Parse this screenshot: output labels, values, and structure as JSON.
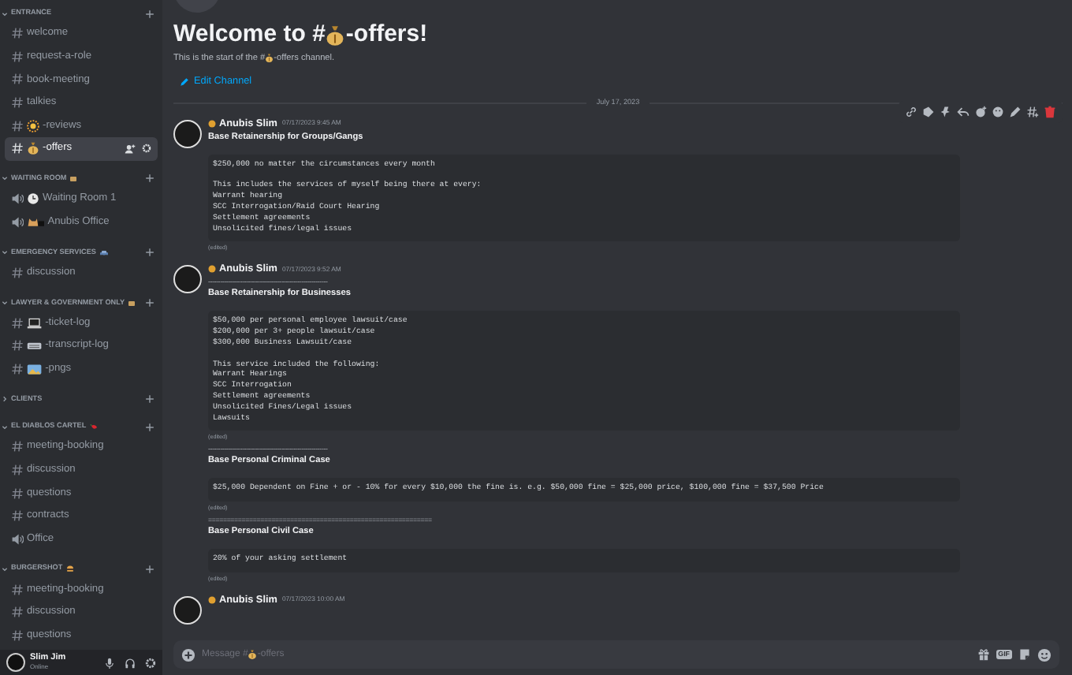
{
  "sidebar": {
    "categories": [
      {
        "name": "ENTRANCE",
        "expanded": true,
        "channels": [
          {
            "name": "welcome",
            "kind": "text",
            "selected": false
          },
          {
            "name": "request-a-role",
            "kind": "text",
            "selected": false
          },
          {
            "name": "book-meeting",
            "kind": "text",
            "selected": false
          },
          {
            "name": "talkies",
            "kind": "text",
            "selected": false
          },
          {
            "name": "-reviews",
            "kind": "text",
            "emoji": {
              "kind": "sun"
            },
            "selected": false
          },
          {
            "name": "-offers",
            "kind": "text",
            "emoji": {
              "kind": "moneybag"
            },
            "selected": true
          }
        ]
      },
      {
        "name": "WAITING ROOM",
        "emoji": {
          "kind": "box"
        },
        "expanded": true,
        "channels": [
          {
            "name": "Waiting Room 1",
            "kind": "voice",
            "emoji": {
              "kind": "clock"
            },
            "selected": false
          },
          {
            "name": "Anubis Office",
            "kind": "voice",
            "emoji": {
              "kind": "dog"
            },
            "selected": false
          }
        ]
      },
      {
        "name": "EMERGENCY SERVICES",
        "emoji": {
          "kind": "car"
        },
        "expanded": true,
        "channels": [
          {
            "name": "discussion",
            "kind": "text",
            "selected": false
          }
        ]
      },
      {
        "name": "LAWYER & GOVERNMENT ONLY",
        "emoji": {
          "kind": "box"
        },
        "expanded": true,
        "channels": [
          {
            "name": "-ticket-log",
            "kind": "text",
            "emoji": {
              "kind": "laptop"
            },
            "selected": false
          },
          {
            "name": "-transcript-log",
            "kind": "text",
            "emoji": {
              "kind": "keyboard"
            },
            "selected": false
          },
          {
            "name": "-pngs",
            "kind": "text",
            "emoji": {
              "kind": "picture"
            },
            "selected": false
          }
        ]
      },
      {
        "name": "CLIENTS",
        "expanded": false
      },
      {
        "name": "EL DIABLOS CARTEL",
        "emoji": {
          "kind": "pepper"
        },
        "expanded": true,
        "channels": [
          {
            "name": "meeting-booking",
            "kind": "text",
            "selected": false
          },
          {
            "name": "discussion",
            "kind": "text",
            "selected": false
          },
          {
            "name": "questions",
            "kind": "text",
            "selected": false
          },
          {
            "name": "contracts",
            "kind": "text",
            "selected": false
          },
          {
            "name": "Office",
            "kind": "voice",
            "selected": false
          }
        ]
      },
      {
        "name": "BURGERSHOT",
        "emoji": {
          "kind": "burger"
        },
        "expanded": true,
        "channels": [
          {
            "name": "meeting-booking",
            "kind": "text",
            "selected": false
          },
          {
            "name": "discussion",
            "kind": "text",
            "selected": false
          },
          {
            "name": "questions",
            "kind": "text",
            "selected": false
          }
        ]
      }
    ],
    "user": {
      "name": "Slim Jim",
      "status": "Online"
    }
  },
  "header": {
    "title_before": "Welcome to #",
    "title_after": "-offers!",
    "subtitle_before": "This is the start of the #",
    "subtitle_after": "-offers channel.",
    "edit_link": "Edit Channel"
  },
  "date_divider": "July 17, 2023",
  "messages": [
    {
      "author": "Anubis Slim",
      "time": "07/17/2023 9:45 AM",
      "blocks": [
        {
          "kind": "heading",
          "text": "Base Retainership for Groups/Gangs"
        },
        {
          "kind": "code",
          "paragraphs": [
            [
              "$250,000 no matter the circumstances every month"
            ],
            [
              "This includes the services of myself being there at every:",
              "Warrant hearing",
              "SCC Interrogation/Raid Court Hearing",
              "Settlement agreements",
              "Unsolicited fines/legal issues"
            ]
          ]
        },
        {
          "kind": "edited",
          "text": "(edited)"
        }
      ]
    },
    {
      "author": "Anubis Slim",
      "time": "07/17/2023 9:52 AM",
      "blocks": [
        {
          "kind": "rule",
          "text": "------------------------------------------------------------"
        },
        {
          "kind": "heading",
          "text": "Base Retainership for Businesses"
        },
        {
          "kind": "code",
          "paragraphs": [
            [
              "$50,000 per personal employee lawsuit/case",
              "$200,000 per 3+ people lawsuit/case",
              "$300,000 Business Lawsuit/case"
            ],
            [
              "This service included the following:",
              "Warrant Hearings",
              "SCC Interrogation",
              "Settlement agreements",
              "Unsolicited Fines/Legal issues",
              "Lawsuits"
            ]
          ]
        },
        {
          "kind": "edited",
          "text": "(edited)"
        },
        {
          "kind": "rule",
          "text": "------------------------------------------------------------"
        },
        {
          "kind": "heading",
          "text": "Base Personal Criminal Case"
        },
        {
          "kind": "code",
          "paragraphs": [
            [
              "$25,000 Dependent on Fine + or - 10% for every $10,000 the fine is. e.g. $50,000 fine = $25,000 price, $100,000 fine = $37,500 Price"
            ]
          ]
        },
        {
          "kind": "edited",
          "text": "(edited)"
        },
        {
          "kind": "rule",
          "text": "============================================================"
        },
        {
          "kind": "heading",
          "text": "Base Personal Civil Case"
        },
        {
          "kind": "code",
          "paragraphs": [
            [
              "20% of your asking settlement"
            ]
          ]
        },
        {
          "kind": "edited",
          "text": "(edited)"
        }
      ]
    },
    {
      "author": "Anubis Slim",
      "time": "07/17/2023 10:00 AM"
    }
  ],
  "composer": {
    "hint_before": "Message #",
    "hint_after": "-offers",
    "gif_label": "GIF"
  }
}
